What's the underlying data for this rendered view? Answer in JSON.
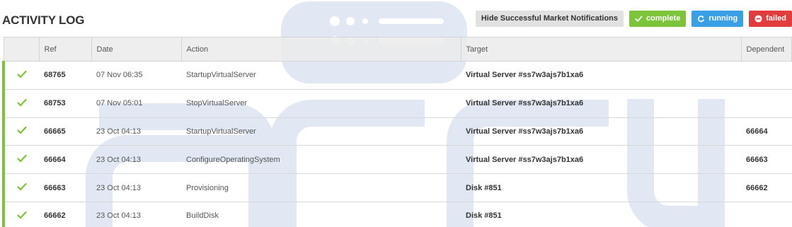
{
  "header": {
    "title": "ACTIVITY LOG",
    "hide_button": "Hide Successful Market Notifications",
    "complete_button": "complete",
    "running_button": "running",
    "failed_button": "failed"
  },
  "table": {
    "columns": [
      "Ref",
      "Date",
      "Action",
      "Target",
      "Dependent"
    ],
    "rows": [
      {
        "ref": "68765",
        "date": "07 Nov 06:35",
        "action": "StartupVirtualServer",
        "target": "Virtual Server #ss7w3ajs7b1xa6",
        "dependent": ""
      },
      {
        "ref": "68753",
        "date": "07 Nov 05:01",
        "action": "StopVirtualServer",
        "target": "Virtual Server #ss7w3ajs7b1xa6",
        "dependent": ""
      },
      {
        "ref": "66665",
        "date": "23 Oct 04:13",
        "action": "StartupVirtualServer",
        "target": "Virtual Server #ss7w3ajs7b1xa6",
        "dependent": "66664"
      },
      {
        "ref": "66664",
        "date": "23 Oct 04:13",
        "action": "ConfigureOperatingSystem",
        "target": "Virtual Server #ss7w3ajs7b1xa6",
        "dependent": "66663"
      },
      {
        "ref": "66663",
        "date": "23 Oct 04:13",
        "action": "Provisioning",
        "target": "Disk #851",
        "dependent": "66662"
      },
      {
        "ref": "66662",
        "date": "23 Oct 04:13",
        "action": "BuildDisk",
        "target": "Disk #851",
        "dependent": ""
      }
    ]
  },
  "colors": {
    "complete": "#7cc43a",
    "running": "#3aa0e6",
    "failed": "#e23d3d"
  },
  "icons": {
    "row_status": "check-icon",
    "complete": "check-icon",
    "running": "refresh-icon",
    "failed": "minus-circle-icon"
  }
}
